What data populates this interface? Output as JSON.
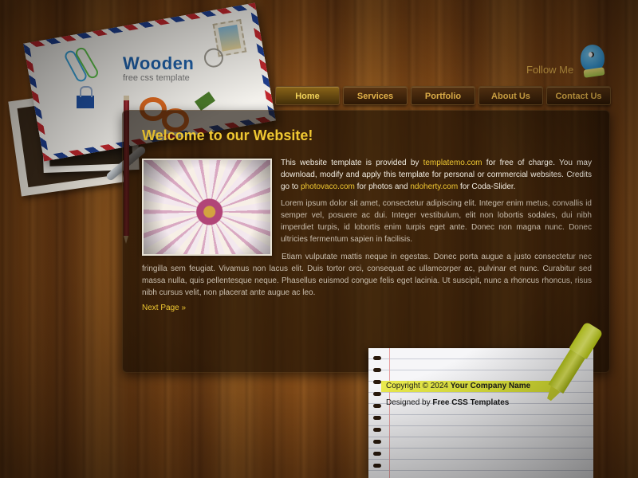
{
  "logo": {
    "title": "Wooden",
    "subtitle": "free css template"
  },
  "social": {
    "follow_label": "Follow Me",
    "icon": "twitter-bird-icon"
  },
  "nav": {
    "items": [
      {
        "label": "Home",
        "active": true
      },
      {
        "label": "Services",
        "active": false
      },
      {
        "label": "Portfolio",
        "active": false
      },
      {
        "label": "About Us",
        "active": false
      },
      {
        "label": "Contact Us",
        "active": false
      }
    ]
  },
  "main": {
    "heading": "Welcome to our Website!",
    "intro": {
      "t1": "This website template is provided by ",
      "link1": "templatemo.com",
      "t2": " for free of charge. You may download, modify and apply this template for personal or commercial websites. Credits go to ",
      "link2": "photovaco.com",
      "t3": " for photos and ",
      "link3": "ndoherty.com",
      "t4": " for Coda-Slider."
    },
    "paragraph2": "Lorem ipsum dolor sit amet, consectetur adipiscing elit. Integer enim metus, convallis id semper vel, posuere ac dui. Integer vestibulum, elit non lobortis sodales, dui nibh imperdiet turpis, id lobortis enim turpis eget ante. Donec non magna nunc. Donec ultricies fermentum sapien in facilisis.",
    "paragraph3": "Etiam vulputate mattis neque in egestas. Donec porta augue a justo consectetur nec fringilla sem feugiat. Vivamus non lacus elit. Duis tortor orci, consequat ac ullamcorper ac, pulvinar et nunc. Curabitur sed massa nulla, quis pellentesque neque. Phasellus euismod congue felis eget lacinia. Ut suscipit, nunc a rhoncus rhoncus, risus nibh cursus velit, non placerat ante augue ac leo.",
    "next_link": "Next Page »"
  },
  "footer": {
    "copyright_prefix": "Copyright © 2024 ",
    "company": "Your Company Name",
    "designed_prefix": "Designed by ",
    "designer": "Free CSS Templates"
  },
  "colors": {
    "accent": "#f0c832",
    "logo_blue": "#1f5fa6",
    "nav_text": "#e2b24a"
  }
}
